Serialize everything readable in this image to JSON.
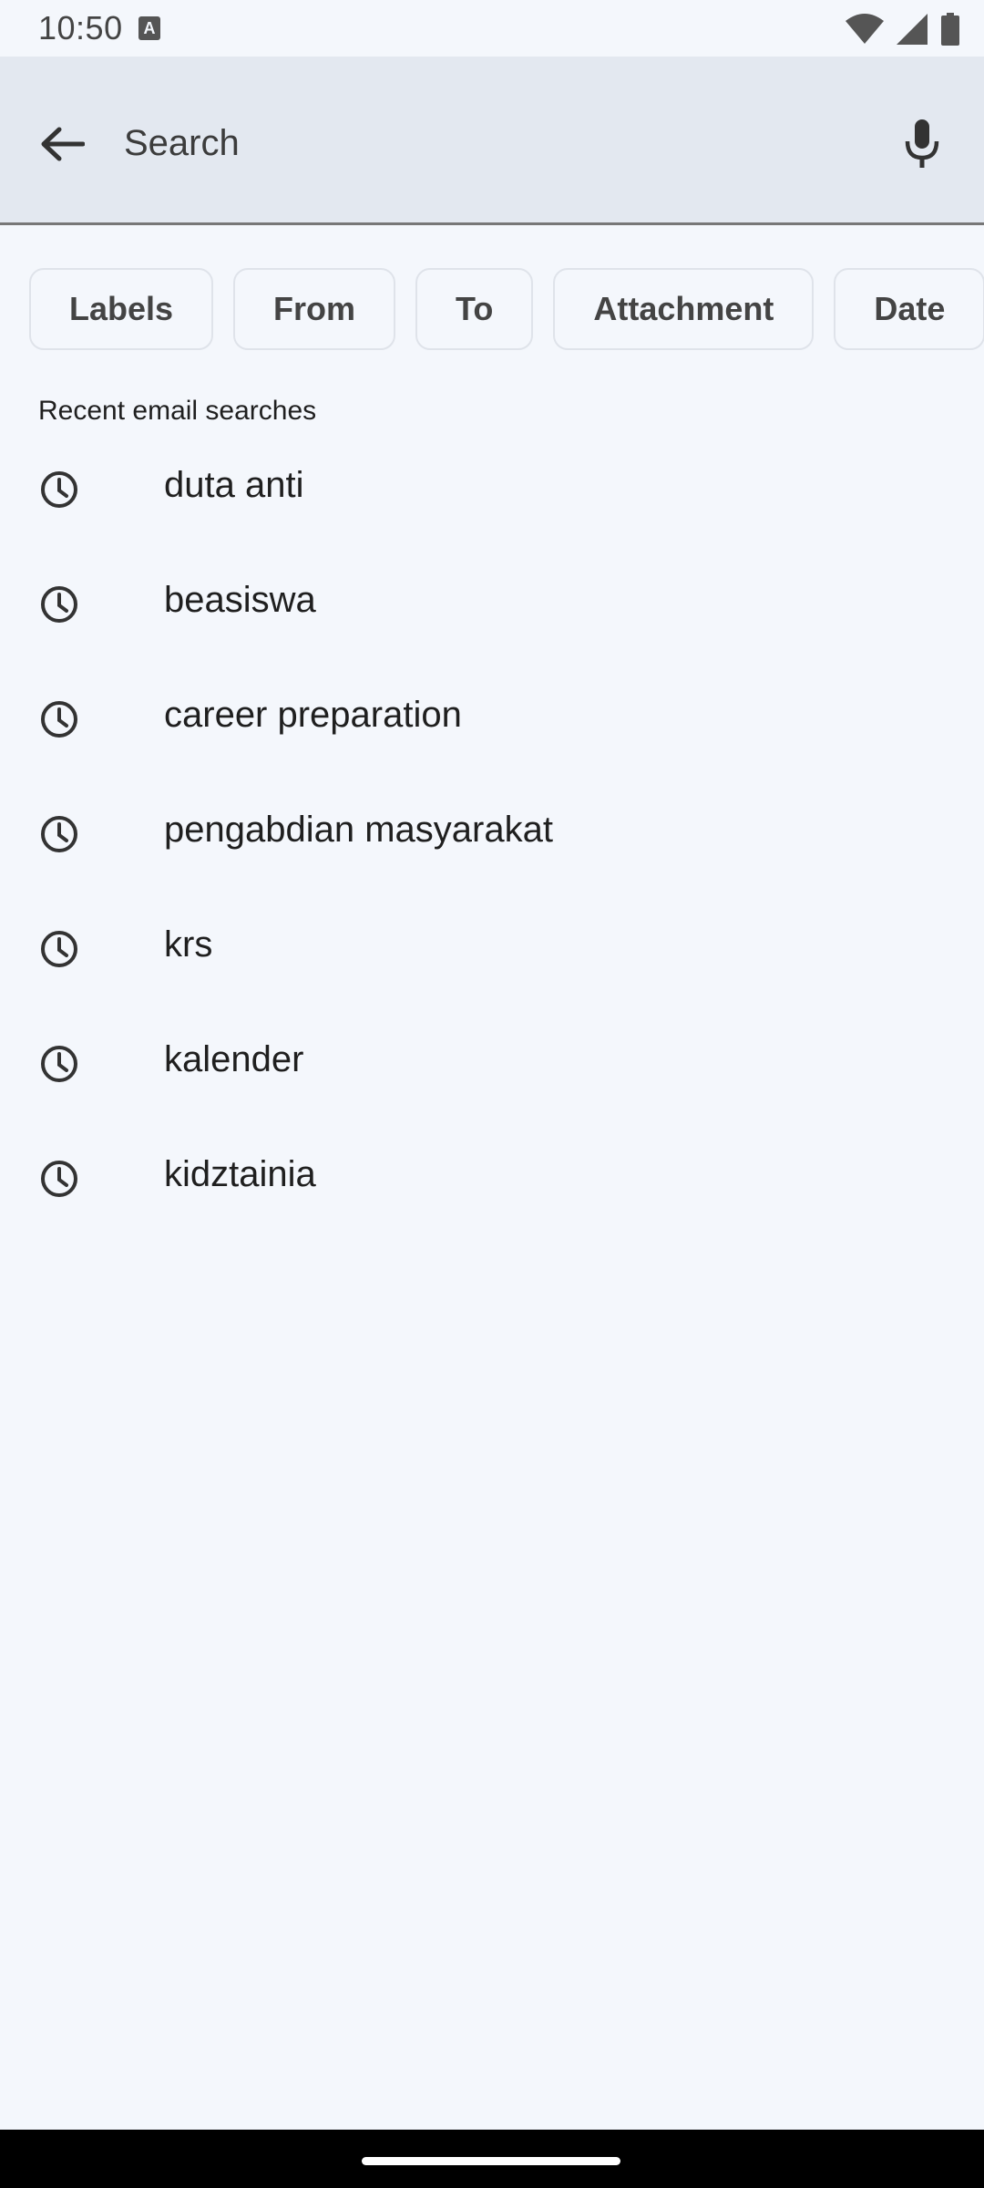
{
  "status_bar": {
    "time": "10:50",
    "notification_icon": "a-icon",
    "icons": [
      "wifi-icon",
      "signal-icon",
      "battery-icon"
    ]
  },
  "search": {
    "back_icon": "arrow-back-icon",
    "placeholder": "Search",
    "mic_icon": "mic-icon"
  },
  "filters": [
    {
      "label": "Labels"
    },
    {
      "label": "From"
    },
    {
      "label": "To"
    },
    {
      "label": "Attachment"
    },
    {
      "label": "Date"
    }
  ],
  "recent": {
    "title": "Recent email searches",
    "icon": "clock-icon",
    "items": [
      {
        "text": "duta anti"
      },
      {
        "text": "beasiswa"
      },
      {
        "text": "career preparation"
      },
      {
        "text": "pengabdian masyarakat"
      },
      {
        "text": "krs"
      },
      {
        "text": "kalender"
      },
      {
        "text": "kidztainia"
      }
    ]
  },
  "colors": {
    "background": "#f4f7fc",
    "search_bar": "#e3e8f0",
    "text": "#1f1f1f"
  }
}
